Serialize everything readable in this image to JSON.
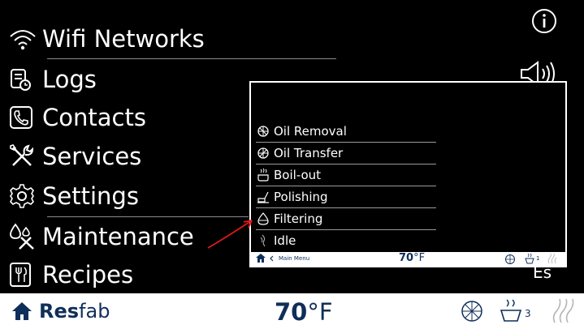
{
  "menu": {
    "items": [
      {
        "label": "Wifi Networks",
        "icon": "wifi-icon"
      },
      {
        "label": "Logs",
        "icon": "logs-icon"
      },
      {
        "label": "Contacts",
        "icon": "phone-icon"
      },
      {
        "label": "Services",
        "icon": "tools-icon"
      },
      {
        "label": "Settings",
        "icon": "gear-icon"
      },
      {
        "label": "Maintenance",
        "icon": "maintenance-icon"
      },
      {
        "label": "Recipes",
        "icon": "recipes-icon"
      }
    ]
  },
  "submenu": {
    "items": [
      {
        "label": "Oil Removal",
        "icon": "oil-removal-icon"
      },
      {
        "label": "Oil Transfer",
        "icon": "oil-transfer-icon"
      },
      {
        "label": "Boil-out",
        "icon": "boil-out-icon"
      },
      {
        "label": "Polishing",
        "icon": "polishing-icon"
      },
      {
        "label": "Filtering",
        "icon": "filtering-icon"
      },
      {
        "label": "Idle",
        "icon": "idle-icon"
      }
    ],
    "status_bar": {
      "back_label": "Main Menu",
      "temperature": "70",
      "unit": "°F",
      "vat_count": "1"
    }
  },
  "language": "Es",
  "status_bar": {
    "brand_bold": "Res",
    "brand_light": "fab",
    "temperature": "70",
    "unit": "°F",
    "vat_count": "3"
  },
  "colors": {
    "brand": "#0f2f5a",
    "annotation_arrow": "#e01818"
  }
}
